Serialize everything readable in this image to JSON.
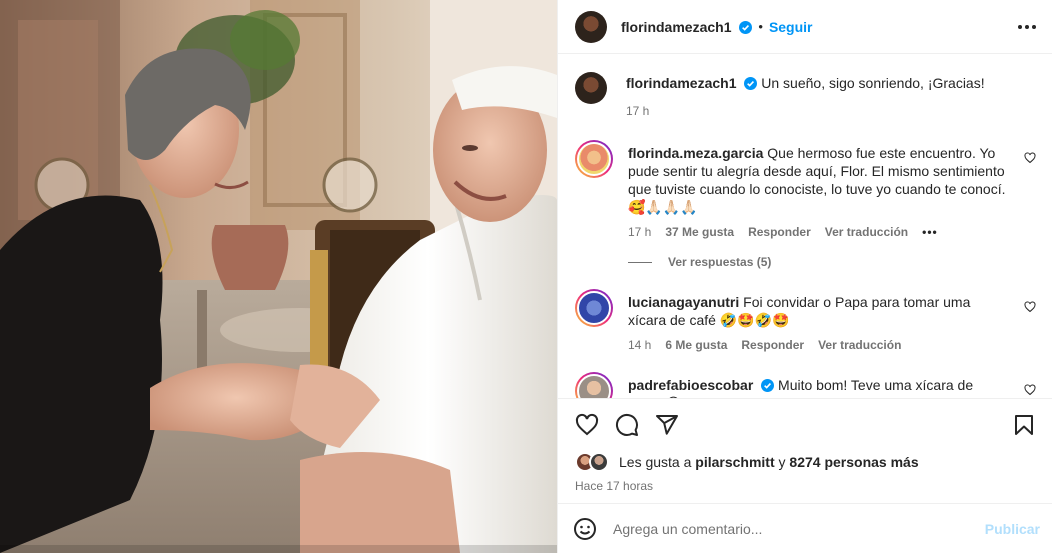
{
  "post": {
    "owner": "florindamezach1",
    "follow_label": "Seguir",
    "dot": "•"
  },
  "caption": {
    "user": "florindamezach1",
    "text": "Un sueño, sigo sonriendo, ¡Gracias!",
    "time": "17 h"
  },
  "comments": [
    {
      "user": "florinda.meza.garcia",
      "text": "Que hermoso fue este encuentro. Yo pude sentir tu alegría desde aquí, Flor. El mismo sentimiento que tuviste cuando lo conociste, lo tuve yo cuando te conocí.🥰🙏🏻🙏🏻🙏🏻",
      "time": "17 h",
      "likes": "37 Me gusta",
      "reply": "Responder",
      "translate": "Ver traducción",
      "view_replies": "Ver respuestas (5)"
    },
    {
      "user": "lucianagayanutri",
      "text": "Foi convidar o Papa para tomar uma xícara de café 🤣🤩🤣🤩",
      "time": "14 h",
      "likes": "6 Me gusta",
      "reply": "Responder",
      "translate": "Ver traducción"
    },
    {
      "user": "padrefabioescobar",
      "text": "Muito bom! Teve uma xícara de café? 😀",
      "time": "",
      "likes": "",
      "reply": "",
      "translate": ""
    }
  ],
  "likes": {
    "prefix": "Les gusta a",
    "user": "pilarschmitt",
    "conj": "y",
    "others": "8274 personas más"
  },
  "posted_ago": "Hace 17 horas",
  "add_comment": {
    "placeholder": "Agrega un comentario...",
    "post_label": "Publicar"
  },
  "colors": {
    "accent": "#0095f6",
    "publish_disabled": "#b2dffc",
    "secondary_text": "#737373"
  },
  "icons": [
    "verified-icon",
    "more-icon",
    "heart-icon",
    "comment-icon",
    "share-icon",
    "save-icon",
    "emoji-icon"
  ]
}
